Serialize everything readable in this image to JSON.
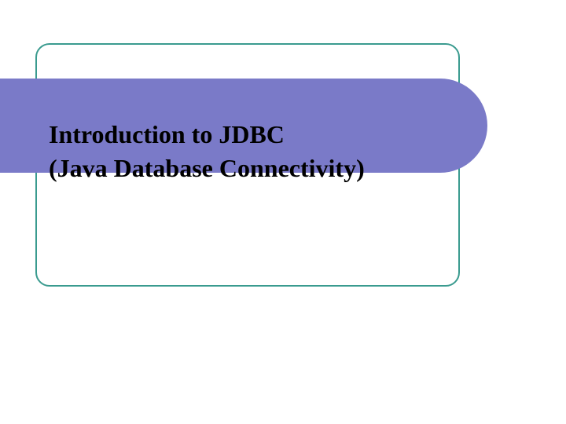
{
  "slide": {
    "title_line1": "Introduction to JDBC",
    "title_line2": "(Java Database Connectivity)",
    "colors": {
      "band": "#7a7ac8",
      "frame_border": "#3a9b8f",
      "text": "#000000",
      "background": "#ffffff"
    }
  }
}
